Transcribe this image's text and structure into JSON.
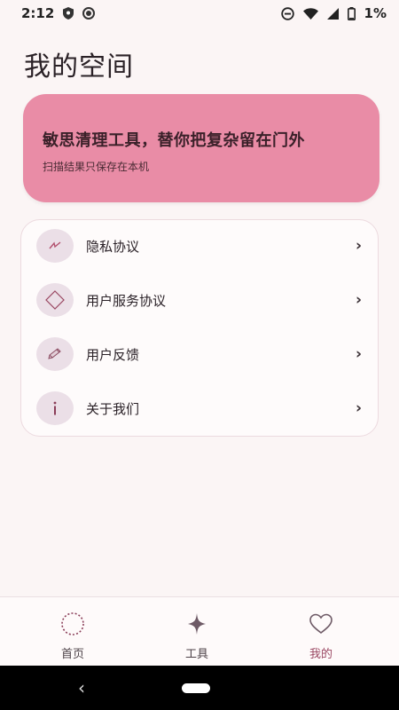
{
  "status_bar": {
    "time": "2:12",
    "battery": "1%",
    "left_icons": [
      "shield-icon",
      "record-icon"
    ],
    "right_icons": [
      "do-not-disturb-icon",
      "wifi-icon",
      "signal-icon",
      "battery-icon"
    ]
  },
  "page": {
    "title": "我的空间"
  },
  "hero": {
    "title": "敏思清理工具，替你把复杂留在门外",
    "subtitle": "扫描结果只保存在本机",
    "color": "#e98ca6"
  },
  "menu": {
    "items": [
      {
        "label": "隐私协议",
        "icon": "lightning-icon"
      },
      {
        "label": "用户服务协议",
        "icon": "diamond-icon"
      },
      {
        "label": "用户反馈",
        "icon": "pencil-icon"
      },
      {
        "label": "关于我们",
        "icon": "info-icon"
      }
    ],
    "chevron": "›"
  },
  "bottom_nav": {
    "items": [
      {
        "label": "首页",
        "icon": "dotted-circle-icon",
        "active": false
      },
      {
        "label": "工具",
        "icon": "sparkle-icon",
        "active": false
      },
      {
        "label": "我的",
        "icon": "heart-icon",
        "active": true
      }
    ],
    "active_color": "#9a4762"
  },
  "system_nav": {
    "back": "‹"
  }
}
